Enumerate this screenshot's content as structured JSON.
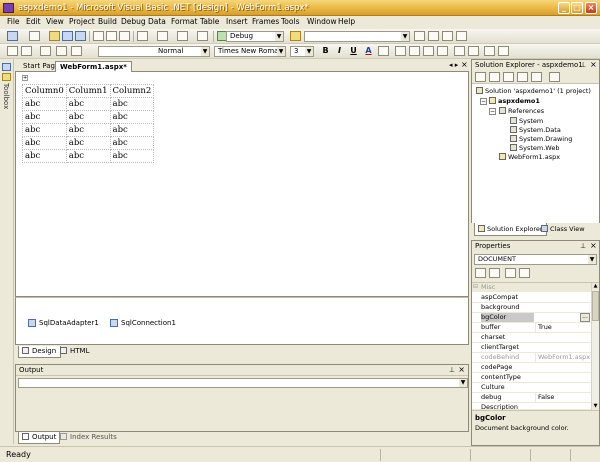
{
  "window": {
    "title": "aspxdemo1 - Microsoft Visual Basic .NET [design] - WebForm1.aspx*"
  },
  "menu": [
    "File",
    "Edit",
    "View",
    "Project",
    "Build",
    "Debug",
    "Data",
    "Format",
    "Table",
    "Insert",
    "Frames",
    "Tools",
    "Window",
    "Help"
  ],
  "toolbar": {
    "config": "Debug"
  },
  "formatbar": {
    "style": "Normal",
    "font": "Times New Roman",
    "size": "3",
    "bold": "B",
    "italic": "I",
    "underline": "U",
    "color": "A"
  },
  "doc_tabs": [
    "Start Page",
    "WebForm1.aspx*"
  ],
  "grid": {
    "headers": [
      "Column0",
      "Column1",
      "Column2"
    ],
    "rows": [
      [
        "abc",
        "abc",
        "abc"
      ],
      [
        "abc",
        "abc",
        "abc"
      ],
      [
        "abc",
        "abc",
        "abc"
      ],
      [
        "abc",
        "abc",
        "abc"
      ],
      [
        "abc",
        "abc",
        "abc"
      ]
    ]
  },
  "tray": [
    "SqlDataAdapter1",
    "SqlConnection1"
  ],
  "view_tabs": [
    "Design",
    "HTML"
  ],
  "output": {
    "title": "Output"
  },
  "bottom_tabs": [
    "Output",
    "Index Results"
  ],
  "status": "Ready",
  "solution_explorer": {
    "title": "Solution Explorer - aspxdemo1",
    "solution": "Solution 'aspxdemo1' (1 project)",
    "project": "aspxdemo1",
    "references": "References",
    "refs": [
      "System",
      "System.Data",
      "System.Drawing",
      "System.Web"
    ],
    "file": "WebForm1.aspx",
    "tabs": [
      "Solution Explorer",
      "Class View"
    ]
  },
  "properties": {
    "title": "Properties",
    "object": "DOCUMENT",
    "category": "Misc",
    "rows": [
      {
        "name": "aspCompat",
        "value": ""
      },
      {
        "name": "background",
        "value": ""
      },
      {
        "name": "bgColor",
        "value": "",
        "ellipsis": "..."
      },
      {
        "name": "buffer",
        "value": "True"
      },
      {
        "name": "charset",
        "value": ""
      },
      {
        "name": "clientTarget",
        "value": ""
      },
      {
        "name": "codeBehind",
        "value": "WebForm1.aspx.vb"
      },
      {
        "name": "codePage",
        "value": ""
      },
      {
        "name": "contentType",
        "value": ""
      },
      {
        "name": "Culture",
        "value": ""
      },
      {
        "name": "debug",
        "value": "False"
      },
      {
        "name": "Description",
        "value": ""
      }
    ],
    "desc_title": "bgColor",
    "desc_text": "Document background color."
  }
}
